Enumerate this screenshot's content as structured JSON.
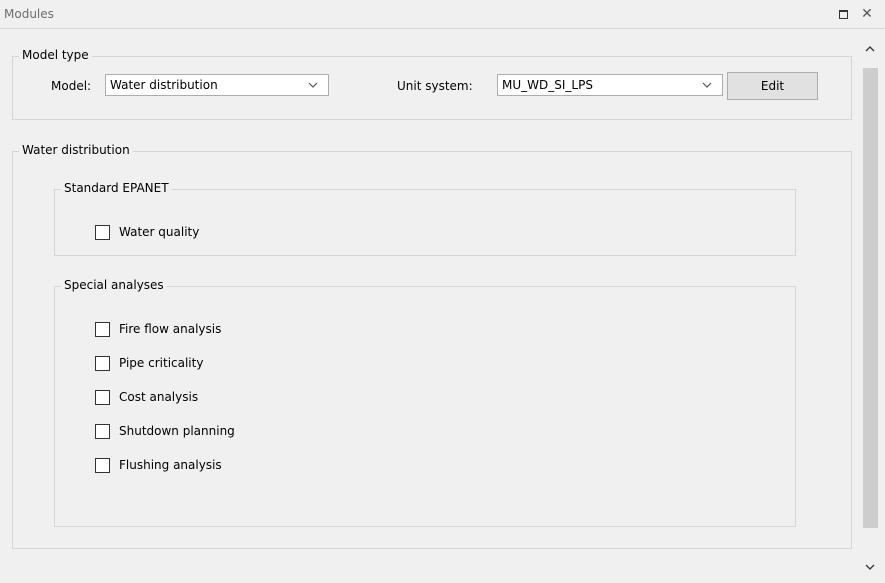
{
  "window": {
    "title": "Modules"
  },
  "model_type": {
    "legend": "Model type",
    "model_label": "Model:",
    "model_value": "Water distribution",
    "unit_label": "Unit system:",
    "unit_value": "MU_WD_SI_LPS",
    "edit_label": "Edit"
  },
  "water_distribution": {
    "legend": "Water distribution",
    "standard": {
      "legend": "Standard EPANET",
      "items": [
        {
          "label": "Water quality",
          "checked": false
        }
      ]
    },
    "special": {
      "legend": "Special analyses",
      "items": [
        {
          "label": "Fire flow analysis",
          "checked": false
        },
        {
          "label": "Pipe criticality",
          "checked": false
        },
        {
          "label": "Cost analysis",
          "checked": false
        },
        {
          "label": "Shutdown planning",
          "checked": false
        },
        {
          "label": "Flushing analysis",
          "checked": false
        }
      ]
    }
  },
  "icons": {
    "restore": "restore-icon",
    "close": "close-icon",
    "scroll_up": "chevron-up-icon",
    "scroll_down": "chevron-down-icon"
  }
}
